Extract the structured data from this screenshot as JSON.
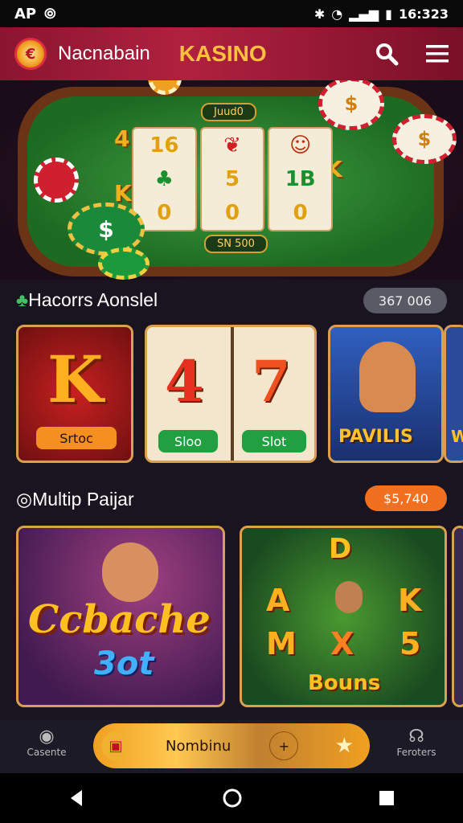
{
  "status_bar": {
    "left_text": "AP",
    "time": "16:323"
  },
  "header": {
    "brand": "Nacnabain",
    "title": "KASINO"
  },
  "table": {
    "top_label": "Juud0",
    "bottom_label": "SN 500",
    "reels": [
      [
        "16",
        "",
        "0"
      ],
      [
        "",
        "5",
        "0"
      ],
      [
        "",
        "1B",
        "0"
      ]
    ],
    "left_symbols": [
      "4",
      "K"
    ],
    "right_symbol": "K",
    "chip_symbol": "$"
  },
  "section1": {
    "title": "Hacorrs Aonslel",
    "badge": "367 006",
    "cards": [
      {
        "letter": "K",
        "button": "Srtoc"
      },
      {
        "digits": [
          "4",
          "7"
        ],
        "buttons": [
          "Sloo",
          "Slot"
        ]
      },
      {
        "title": "PAVILIS",
        "partial": "W"
      }
    ]
  },
  "section2": {
    "title": "Multip Paijar",
    "badge": "$5,740",
    "cards": [
      {
        "line1": "Ccbache",
        "line2": "3ot"
      },
      {
        "top": "D",
        "cells": [
          "A",
          "",
          "K",
          "M",
          "X",
          "5"
        ],
        "banner": "Bouns"
      }
    ]
  },
  "bottom_nav": {
    "left_label": "Casente",
    "center_label": "Nombinu",
    "center_plus": "+",
    "right_label": "Feroters"
  },
  "colors": {
    "header": "#b0213f",
    "accent": "#ffc040",
    "felt": "#2e8a32"
  }
}
